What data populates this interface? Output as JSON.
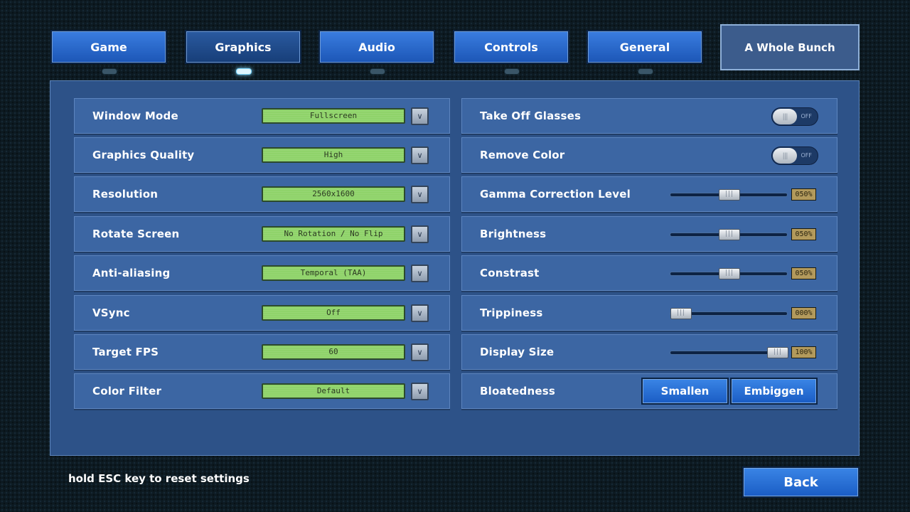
{
  "tabs": [
    {
      "label": "Game",
      "active": false
    },
    {
      "label": "Graphics",
      "active": true
    },
    {
      "label": "Audio",
      "active": false
    },
    {
      "label": "Controls",
      "active": false
    },
    {
      "label": "General",
      "active": false
    },
    {
      "label": "A Whole Bunch",
      "active": false
    }
  ],
  "left_settings": [
    {
      "label": "Window Mode",
      "value": "Fullscreen"
    },
    {
      "label": "Graphics Quality",
      "value": "High"
    },
    {
      "label": "Resolution",
      "value": "2560x1600"
    },
    {
      "label": "Rotate Screen",
      "value": "No Rotation / No Flip"
    },
    {
      "label": "Anti-aliasing",
      "value": "Temporal (TAA)"
    },
    {
      "label": "VSync",
      "value": "Off"
    },
    {
      "label": "Target FPS",
      "value": "60"
    },
    {
      "label": "Color Filter",
      "value": "Default"
    }
  ],
  "toggles": [
    {
      "label": "Take Off Glasses",
      "state": "OFF"
    },
    {
      "label": "Remove Color",
      "state": "OFF"
    }
  ],
  "sliders": [
    {
      "label": "Gamma Correction Level",
      "value": 50,
      "display": "050%"
    },
    {
      "label": "Brightness",
      "value": 50,
      "display": "050%"
    },
    {
      "label": "Constrast",
      "value": 50,
      "display": "050%"
    },
    {
      "label": "Trippiness",
      "value": 0,
      "display": "000%"
    },
    {
      "label": "Display Size",
      "value": 100,
      "display": "100%"
    }
  ],
  "bloatedness": {
    "label": "Bloatedness",
    "smallen": "Smallen",
    "embiggen": "Embiggen"
  },
  "hint": "hold ESC key to reset settings",
  "back_label": "Back",
  "colors": {
    "accent": "#1c56b6",
    "dropdown_lcd": "#8fd36a",
    "panel": "#2d5288"
  }
}
